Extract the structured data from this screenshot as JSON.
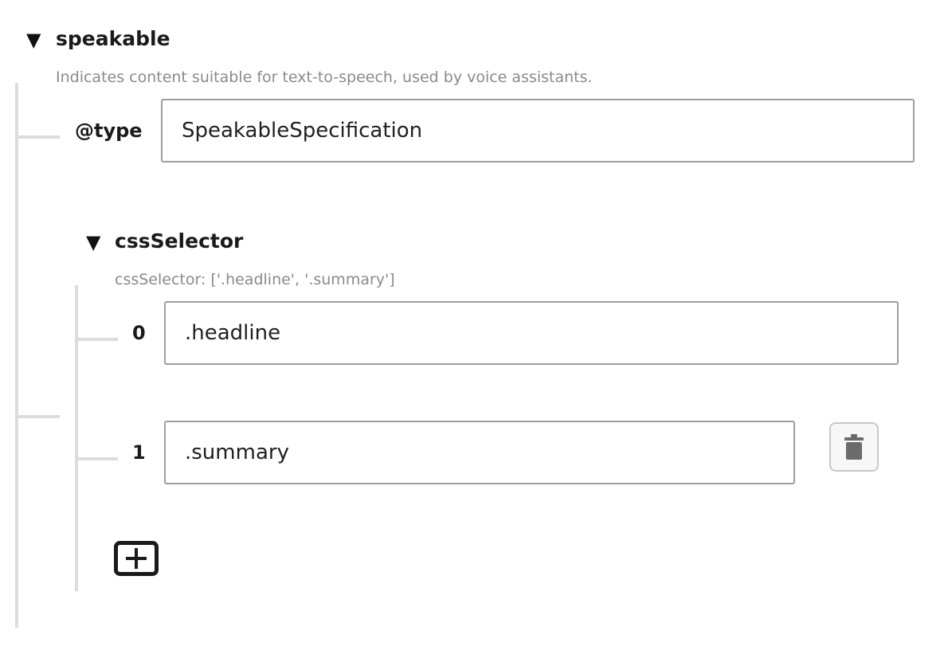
{
  "speakable": {
    "toggle": "▼",
    "title": "speakable",
    "description": "Indicates content suitable for text-to-speech, used by voice assistants.",
    "type_label": "@type",
    "type_value": "SpeakableSpecification",
    "css_selector": {
      "toggle": "▼",
      "title": "cssSelector",
      "description": "cssSelector: ['.headline', '.summary']",
      "items": [
        {
          "index": "0",
          "value": ".headline"
        },
        {
          "index": "1",
          "value": ".summary"
        }
      ],
      "delete_icon": "trash-icon",
      "add_icon": "plus-square-icon"
    }
  }
}
